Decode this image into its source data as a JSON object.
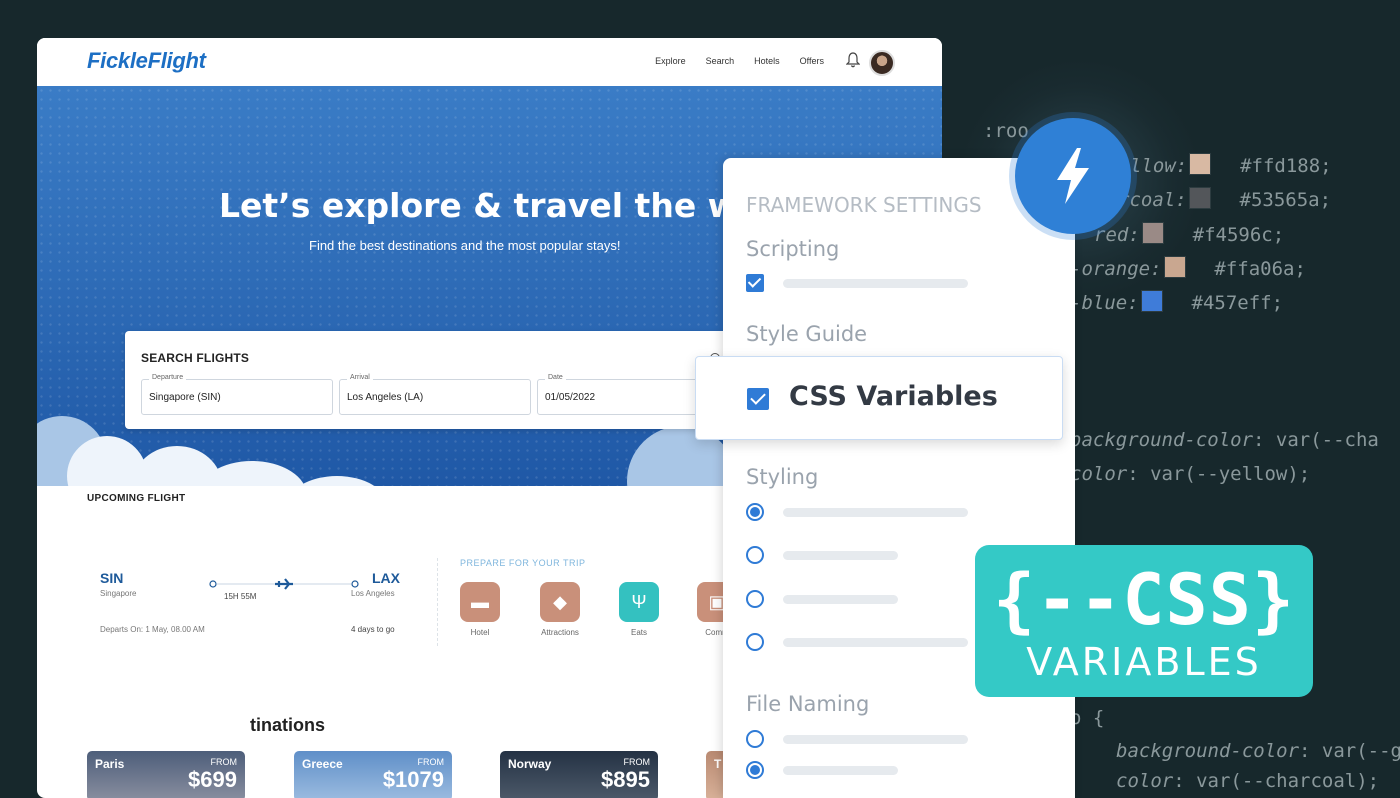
{
  "code": {
    "root": ":roo",
    "vars": [
      {
        "name": "llow:",
        "value": "#ffd188;",
        "swatch": "#d8b9a3"
      },
      {
        "name": "rcoal:",
        "value": "#53565a;",
        "swatch": "#53565a"
      },
      {
        "name": "red:",
        "value": "#f4596c;",
        "swatch": "#9a8a86"
      },
      {
        "name": "-orange:",
        "value": "#ffa06a;",
        "swatch": "#c9a790"
      },
      {
        "name": "-blue:",
        "value": "#457eff;",
        "swatch": "#3f7cd9"
      }
    ],
    "rule1": [
      {
        "prop": "background-color",
        "val": "var(--cha"
      },
      {
        "prop": "color",
        "val": "var(--yellow);"
      }
    ],
    "rule2_open": "o {",
    "rule2": [
      {
        "prop": "background-color",
        "val": "var(--g"
      },
      {
        "prop": "color",
        "val": "var(--charcoal);"
      }
    ]
  },
  "app": {
    "logo": "FickleFlight",
    "nav": [
      "Explore",
      "Search",
      "Hotels",
      "Offers"
    ],
    "hero": {
      "title": "Let’s explore & travel the wor",
      "subtitle": "Find the best destinations and the most popular stays!"
    },
    "search": {
      "title": "SEARCH FLIGHTS",
      "fields": [
        {
          "label": "Departure",
          "value": "Singapore (SIN)"
        },
        {
          "label": "Arrival",
          "value": "Los Angeles (LA)"
        },
        {
          "label": "Date",
          "value": "01/05/2022"
        }
      ]
    },
    "upcoming": {
      "title": "UPCOMING FLIGHT",
      "from_code": "SIN",
      "from_city": "Singapore",
      "to_code": "LAX",
      "to_city": "Los Angeles",
      "duration": "15H 55M",
      "departs": "Departs On: 1 May, 08.00 AM",
      "countdown": "4 days to go"
    },
    "prepare": {
      "title": "PREPARE FOR YOUR TRIP",
      "items": [
        {
          "label": "Hotel",
          "color": "#c9907a",
          "icon": "bed-icon"
        },
        {
          "label": "Attractions",
          "color": "#c9907a",
          "icon": "ticket-icon"
        },
        {
          "label": "Eats",
          "color": "#34c1c0",
          "icon": "cutlery-icon"
        },
        {
          "label": "Comm",
          "color": "#c9907a",
          "icon": "bus-icon"
        }
      ]
    },
    "destinations": {
      "title": "tinations",
      "items": [
        {
          "name": "Paris",
          "from": "FROM",
          "price": "$699"
        },
        {
          "name": "Greece",
          "from": "FROM",
          "price": "$1079"
        },
        {
          "name": "Norway",
          "from": "FROM",
          "price": "$895"
        },
        {
          "name": "T",
          "from": "",
          "price": ""
        }
      ]
    }
  },
  "panel": {
    "title": "FRAMEWORK SETTINGS",
    "scripting": "Scripting",
    "style_guide": "Style Guide",
    "css_variables": "CSS Variables",
    "styling": "Styling",
    "file_naming": "File Naming"
  },
  "badge": {
    "big": "{--CSS}",
    "small": "VARIABLES"
  },
  "colors": {
    "brand": "#1d6fc4",
    "accent": "#34c9c6",
    "check": "#2f7bd6"
  }
}
